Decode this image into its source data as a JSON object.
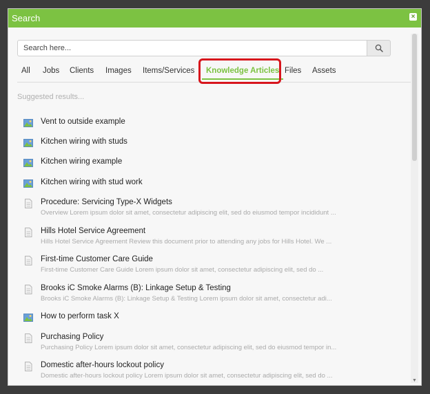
{
  "dialog": {
    "title": "Search",
    "close_label": "×"
  },
  "search": {
    "placeholder": "Search here..."
  },
  "tabs": [
    {
      "label": "All"
    },
    {
      "label": "Jobs"
    },
    {
      "label": "Clients"
    },
    {
      "label": "Images"
    },
    {
      "label": "Items/Services"
    },
    {
      "label": "Knowledge Articles",
      "active": true
    },
    {
      "label": "Files"
    },
    {
      "label": "Assets"
    }
  ],
  "suggested_label": "Suggested results...",
  "results": [
    {
      "icon": "image-icon",
      "title": "Vent to outside example",
      "desc": ""
    },
    {
      "icon": "image-icon",
      "title": "Kitchen wiring with studs",
      "desc": ""
    },
    {
      "icon": "image-icon",
      "title": "Kitchen wiring example",
      "desc": ""
    },
    {
      "icon": "image-icon",
      "title": "Kitchen wiring with stud work",
      "desc": ""
    },
    {
      "icon": "document-icon",
      "title": "Procedure: Servicing Type-X Widgets",
      "desc": "Overview Lorem ipsum dolor sit amet, consectetur adipiscing elit, sed do eiusmod tempor incididunt ..."
    },
    {
      "icon": "document-icon",
      "title": "Hills Hotel Service Agreement",
      "desc": "Hills Hotel Service Agreement Review this document prior to attending any jobs for Hills Hotel. We ..."
    },
    {
      "icon": "document-icon",
      "title": "First-time Customer Care Guide",
      "desc": "First-time Customer Care Guide Lorem ipsum dolor sit amet, consectetur adipiscing elit, sed do ..."
    },
    {
      "icon": "document-icon",
      "title": "Brooks iC Smoke Alarms (B): Linkage Setup & Testing",
      "desc": "Brooks iC Smoke Alarms (B): Linkage Setup & Testing Lorem ipsum dolor sit amet, consectetur adi..."
    },
    {
      "icon": "image-icon",
      "title": "How to perform task X",
      "desc": ""
    },
    {
      "icon": "document-icon",
      "title": "Purchasing Policy",
      "desc": "Purchasing Policy Lorem ipsum dolor sit amet, consectetur adipiscing elit, sed do eiusmod tempor in..."
    },
    {
      "icon": "document-icon",
      "title": "Domestic after-hours lockout policy",
      "desc": "Domestic after-hours lockout policy Lorem ipsum dolor sit amet, consectetur adipiscing elit, sed do ..."
    }
  ],
  "colors": {
    "accent": "#7cc242",
    "highlight": "#d7151c"
  }
}
